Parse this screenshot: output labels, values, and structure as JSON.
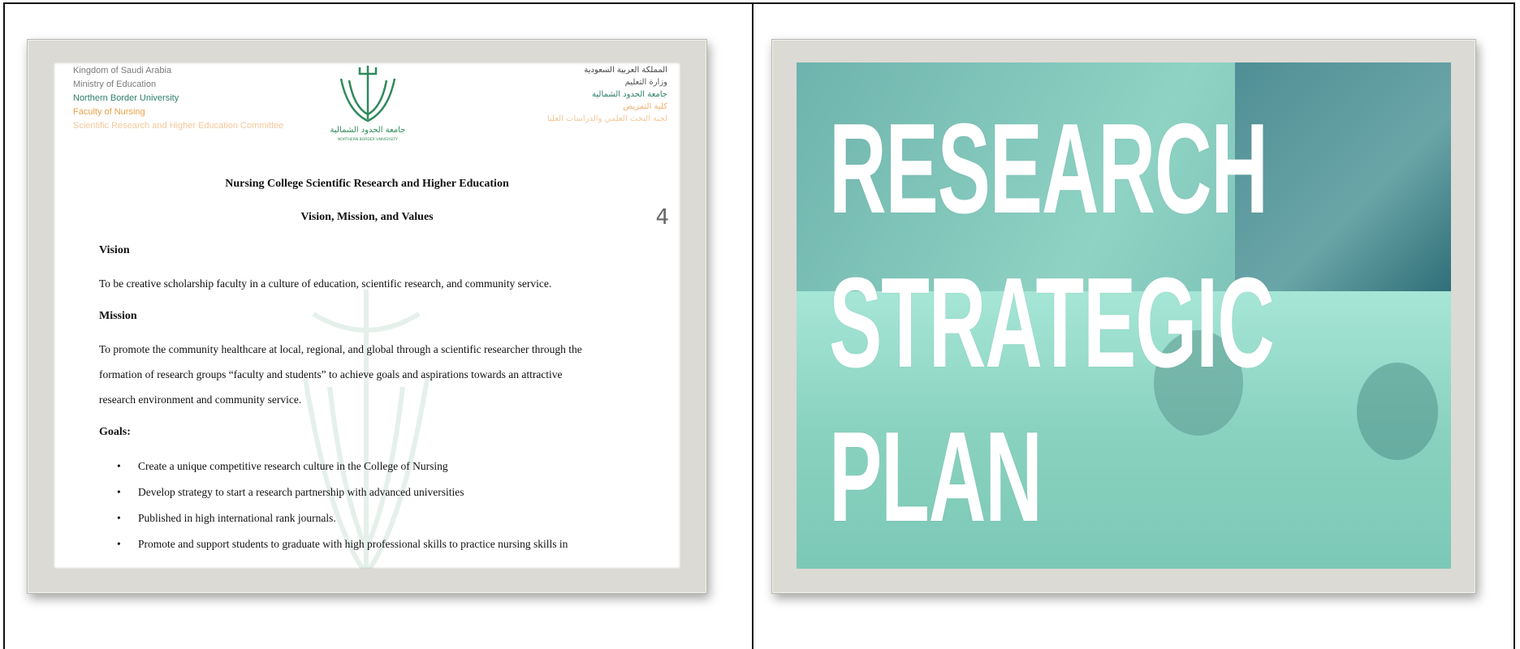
{
  "left_slide": {
    "header_left": {
      "line1": "Kingdom of Saudi Arabia",
      "line2": "Ministry of Education",
      "line3": "Northern Border University",
      "line4": "Faculty of Nursing",
      "line5": "Scientific Research and Higher Education Committee"
    },
    "header_right": {
      "line1": "المملكة العربية السعودية",
      "line2": "وزارة التعليم",
      "line3": "جامعة الحدود الشمالية",
      "line4": "كلية التمريض",
      "line5": "لجنة البحث العلمي والدراسات العليا"
    },
    "logo_text": "جامعة الحدود الشمالية",
    "logo_subtext": "NORTHERN BORDER UNIVERSITY",
    "title": "Nursing College Scientific Research and Higher Education",
    "subtitle": "Vision, Mission, and Values",
    "page_number": "4",
    "vision_heading": "Vision",
    "vision_text": "To be creative scholarship faculty in a culture of education, scientific research, and community service.",
    "mission_heading": "Mission",
    "mission_line1": "To promote the community healthcare at local, regional, and global through a scientific researcher through the",
    "mission_line2": "formation of research groups “faculty and students” to achieve goals and aspirations towards an attractive",
    "mission_line3": "research environment and community service.",
    "goals_heading": "Goals:",
    "goals": [
      "Create a unique competitive research culture in the College of Nursing",
      "Develop strategy to start a research partnership with advanced universities",
      "Published in high international rank journals.",
      "Promote and support students to graduate with high professional skills to practice nursing skills in"
    ]
  },
  "right_slide": {
    "title_line1": "RESEARCH",
    "title_line2": "STRATEGIC",
    "title_line3": "PLAN"
  }
}
